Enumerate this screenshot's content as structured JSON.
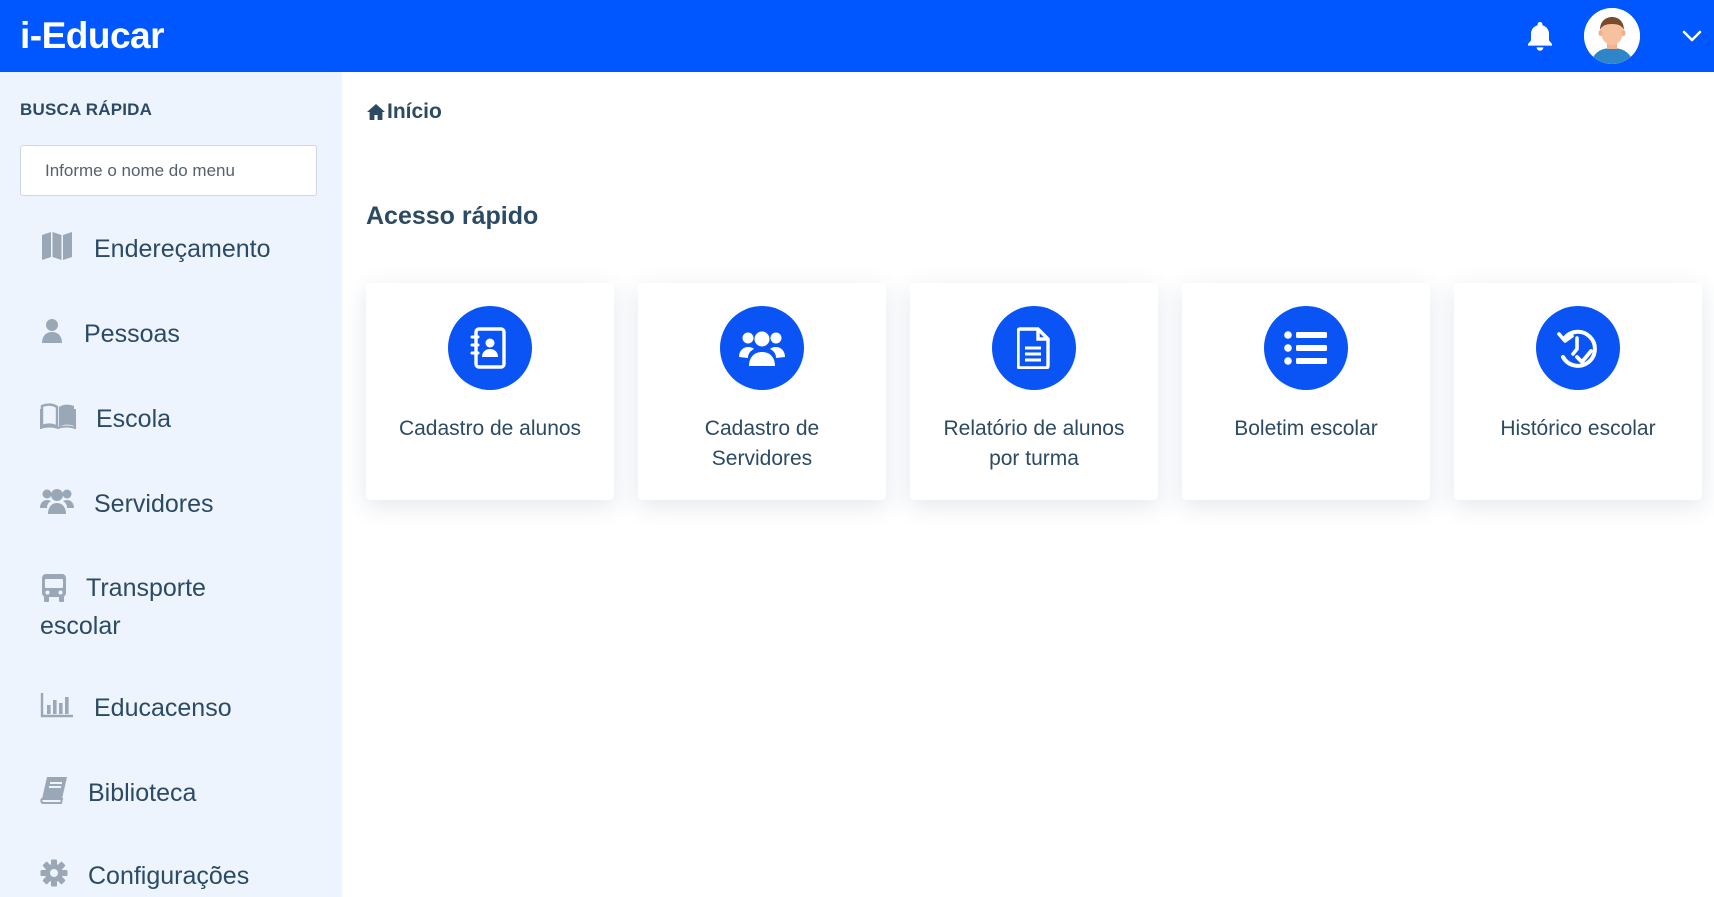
{
  "app": {
    "title": "i-Educar"
  },
  "colors": {
    "primary": "#0057ff",
    "icon_circle": "#0a54f5",
    "sidebar_bg": "#eef4fd",
    "text": "#2b4a63"
  },
  "header": {
    "notification_icon": "bell-icon",
    "avatar_icon": "user-avatar",
    "menu_icon": "chevron-down-icon"
  },
  "sidebar": {
    "quick_search_title": "BUSCA RÁPIDA",
    "search_placeholder": "Informe o nome do menu",
    "items": [
      {
        "label": "Endereçamento",
        "icon": "map-icon"
      },
      {
        "label": "Pessoas",
        "icon": "person-icon"
      },
      {
        "label": "Escola",
        "icon": "open-book-icon"
      },
      {
        "label": "Servidores",
        "icon": "users-icon"
      },
      {
        "label": "Transporte escolar",
        "icon": "bus-icon"
      },
      {
        "label": "Educacenso",
        "icon": "bar-chart-icon"
      },
      {
        "label": "Biblioteca",
        "icon": "book-icon"
      },
      {
        "label": "Configurações",
        "icon": "gear-icon"
      }
    ]
  },
  "main": {
    "breadcrumb": "Início",
    "section_title": "Acesso rápido",
    "cards": [
      {
        "label": "Cadastro de alunos",
        "icon": "contact-book-icon"
      },
      {
        "label": "Cadastro de Servidores",
        "icon": "users-icon"
      },
      {
        "label": "Relatório de alunos por turma",
        "icon": "document-icon"
      },
      {
        "label": "Boletim escolar",
        "icon": "list-icon"
      },
      {
        "label": "Histórico escolar",
        "icon": "history-check-icon"
      }
    ]
  }
}
